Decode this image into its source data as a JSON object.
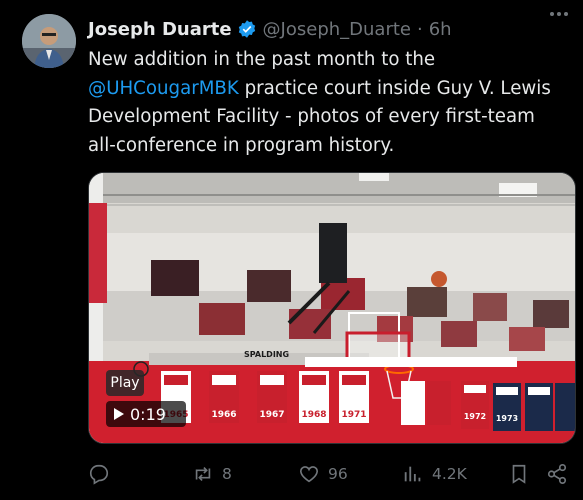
{
  "post": {
    "author": {
      "name": "Joseph Duarte",
      "handle": "@Joseph_Duarte",
      "separator": "·",
      "time": "6h"
    },
    "text_before": "New addition in the past month to the ",
    "mention": "@UHCougarMBK",
    "text_after": " practice court inside Guy V. Lewis Development Facility - photos of every first-team all-conference in program history.",
    "media": {
      "play_label": "Play",
      "duration": "0:19",
      "backboard_brand": "SPALDING",
      "banner_years": [
        "1965",
        "1966",
        "1967",
        "1968",
        "1971",
        "1972",
        "1973"
      ]
    },
    "actions": {
      "replies": "",
      "reposts": "8",
      "likes": "96",
      "views": "4.2K"
    }
  },
  "colors": {
    "accent": "#1d9bf0",
    "muted": "#71767b",
    "text": "#e7e9ea",
    "background": "#000000"
  },
  "icons": [
    "verified-badge-icon",
    "more-icon",
    "reply-icon",
    "repost-icon",
    "like-icon",
    "views-icon",
    "bookmark-icon",
    "share-icon",
    "play-icon"
  ]
}
